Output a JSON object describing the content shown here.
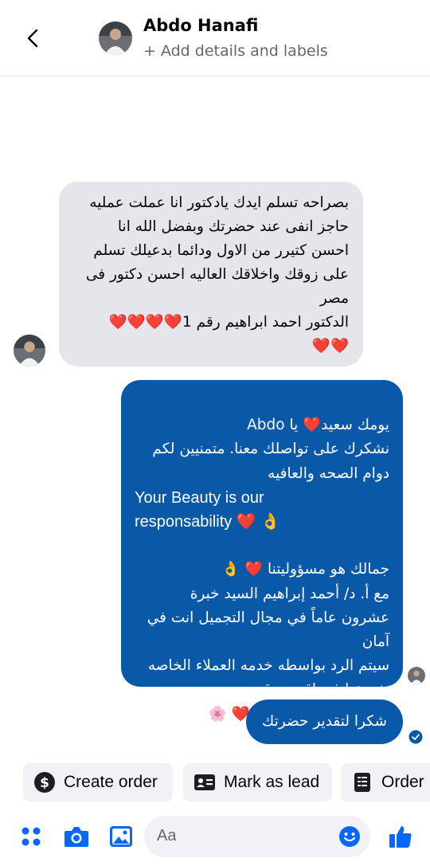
{
  "header": {
    "contact_name": "Abdo Hanafi",
    "subtitle": "+ Add details and labels"
  },
  "messages": {
    "incoming_1": "بصراحه تسلم ايدك يادكتور انا عملت عمليه\nحاجز انفى  عند حضرتك وبفضل الله انا\nاحسن كتيرر  من الاول ودائما بدعيلك تسلم\nعلى زوقك واخلاقك العاليه احسن دكتور فى\nمصر\nالدكتور احمد ابراهيم رقم 1❤️❤️❤️❤️\n❤️❤️",
    "outgoing_1_part1": "يومك سعيد❤️ يا Abdo\nنشكرك على تواصلك معنا. متمنيين لكم\nدوام الصحه والعافيه",
    "outgoing_1_english": "Your Beauty is our\nresponsability ❤️ 👌",
    "outgoing_1_part2": "جمالك هو مسؤوليتنا ❤️ 👌\nمع أ. د/ أحمد إبراهيم السيد خبرة\nعشرون عاماً في مجال التجميل انت في\nآمان\nسيتم الرد بواسطه خدمه العملاء الخاصه\nبفروعنا في اقرب وقت\nشكرا لإختياركم خدمتنا ❤️ 🌸",
    "outgoing_2": "شكرا لتقدير حضرتك"
  },
  "quick_actions": [
    {
      "label": "Create order",
      "icon": "dollar-circle-icon"
    },
    {
      "label": "Mark as lead",
      "icon": "contact-card-icon"
    },
    {
      "label": "Order",
      "icon": "receipt-icon"
    }
  ],
  "composer": {
    "placeholder": "Aa"
  },
  "colors": {
    "accent": "#0a58a8",
    "incoming_bubble": "#e4e6eb",
    "icon_blue": "#0866ff"
  }
}
